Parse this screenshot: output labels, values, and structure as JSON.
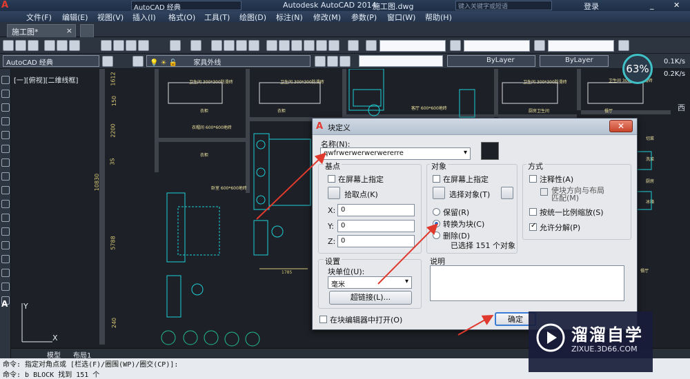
{
  "window_title": "Autodesk AutoCAD 2014",
  "doc_title": "施工图.dwg",
  "quick_access": {
    "workspace": "AutoCAD 经典",
    "search_placeholder": "键入关键字或短语",
    "login": "登录"
  },
  "menu": [
    "文件(F)",
    "编辑(E)",
    "视图(V)",
    "插入(I)",
    "格式(O)",
    "工具(T)",
    "绘图(D)",
    "标注(N)",
    "修改(M)",
    "参数(P)",
    "窗口(W)",
    "帮助(H)"
  ],
  "file_tab": "施工图*",
  "toolbar2": {
    "workspace": "AutoCAD 经典",
    "layer": "家具外线",
    "linetype1": "ByLayer",
    "linetype2": "ByLayer",
    "linetype3": "ByLayer"
  },
  "viewport_label": "[一][俯视][二维线框]",
  "gauge": {
    "percent": "63%",
    "up": "0.1K/s",
    "down": "0.2K/s"
  },
  "drawing": {
    "rooms": [
      "卫生间\n300*300防滑砖",
      "卫生间\n300*300防滑砖",
      "卫生间\n300*300防滑砖",
      "卫生间\n300*300防滑砖",
      "卫生间\n300*300防滑砖"
    ],
    "labels": [
      "衣柜",
      "衣柜",
      "衣帽间\n600*600地砖",
      "衣柜",
      "卧室\n600*600地砖",
      "客厅\n600*600地砖",
      "厨房卫生间",
      "餐厅",
      "西"
    ],
    "side_labels": [
      "切菜",
      "洗菜",
      "厨房",
      "冰箱",
      "餐厅"
    ],
    "dims_v": [
      "1612",
      "150",
      "2200",
      "3S",
      "10830",
      "5788",
      "240"
    ],
    "dim_h": "1785",
    "axis_y": "Y",
    "axis_x": "X"
  },
  "layout_tabs": [
    "模型",
    "布局1"
  ],
  "commands": [
    "命令: 指定对角点或 [栏选(F)/圈围(WP)/圈交(CP)]:",
    "命令: b BLOCK 找到 151 个"
  ],
  "dialog": {
    "title": "块定义",
    "name_label": "名称(N):",
    "name_value": "qwfrwerwerwerwererre",
    "base_group": "基点",
    "base_onscreen": "在屏幕上指定",
    "pick_point": "拾取点(K)",
    "x_label": "X:",
    "x_value": "0",
    "y_label": "Y:",
    "y_value": "0",
    "z_label": "Z:",
    "z_value": "0",
    "obj_group": "对象",
    "obj_onscreen": "在屏幕上指定",
    "select_objects": "选择对象(T)",
    "retain": "保留(R)",
    "convert": "转换为块(C)",
    "delete": "删除(D)",
    "selected_count": "已选择 151 个对象",
    "behavior_group": "方式",
    "annotative": "注释性(A)",
    "match_orient": "使块方向与布局\n匹配(M)",
    "scale_uniform": "按统一比例缩放(S)",
    "allow_explode": "允许分解(P)",
    "settings_group": "设置",
    "block_unit": "块单位(U):",
    "unit_value": "毫米",
    "hyperlink": "超链接(L)...",
    "description": "说明",
    "open_in_editor": "在块编辑器中打开(O)",
    "ok": "确定"
  },
  "watermark": {
    "title": "溜溜自学",
    "url": "ZIXUE.3D66.COM"
  },
  "colors": {
    "accent": "#3fc1c6",
    "arrow": "#e03a2e",
    "cad_text": "#f0e6a2",
    "cyan_lines": "#1fd0d8"
  }
}
